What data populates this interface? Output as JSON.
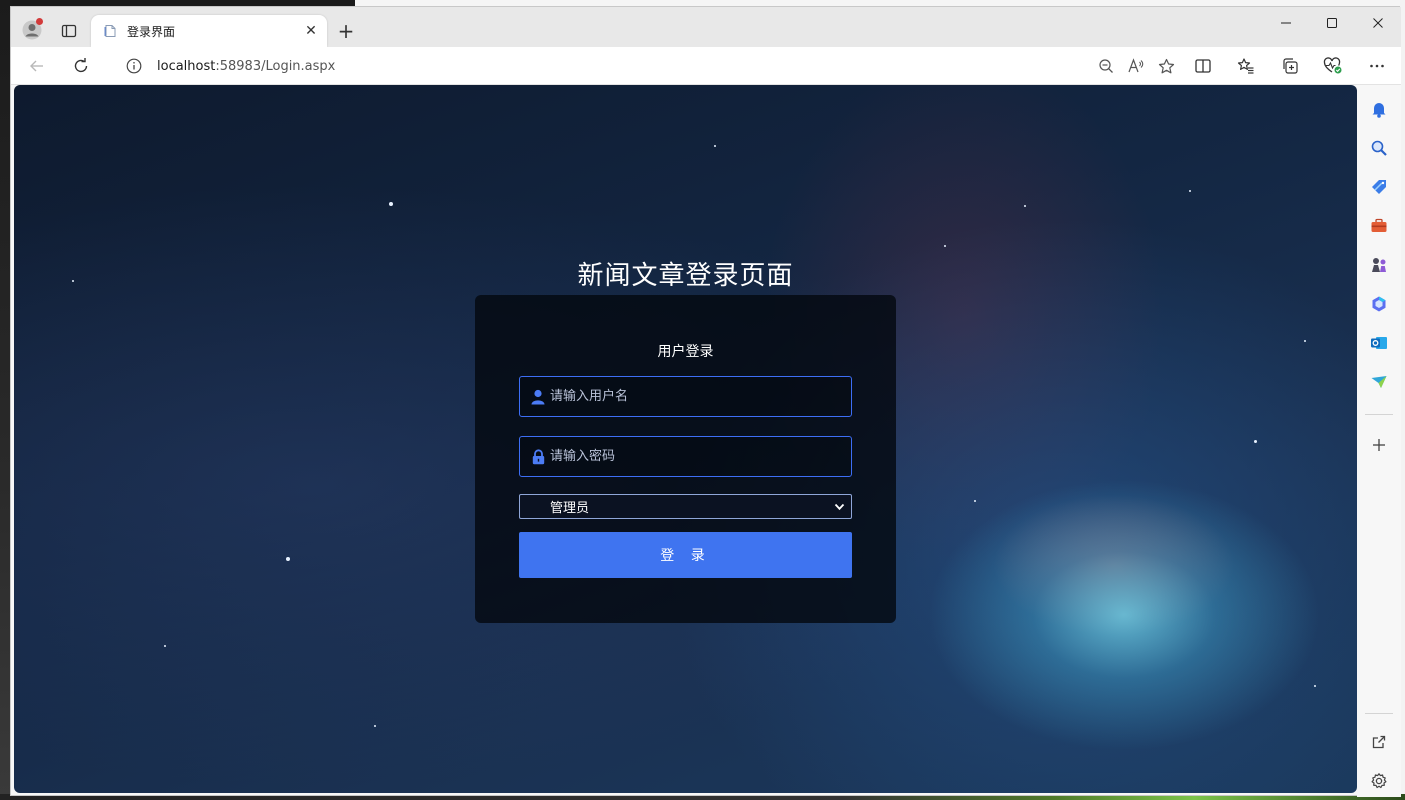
{
  "browser": {
    "tab": {
      "title": "登录界面",
      "close_glyph": "✕"
    },
    "new_tab_glyph": "+",
    "window_controls": {
      "minimize_glyph": "—",
      "maximize_glyph": "☐",
      "close_glyph": "✕"
    },
    "address": {
      "host": "localhost",
      "rest": ":58983/Login.aspx"
    },
    "icons": {
      "profile": "profile-icon",
      "tab_actions": "tab-actions-icon",
      "back": "back-arrow-icon",
      "refresh": "refresh-icon",
      "info": "info-icon",
      "zoom_out": "zoom-out-icon",
      "read_aloud": "read-aloud-icon",
      "favorite": "star-icon",
      "split_screen": "split-screen-icon",
      "favorites": "favorites-icon",
      "collections": "collections-icon",
      "performance": "performance-icon",
      "more": "more-icon"
    },
    "sidebar_icons": [
      "bell-icon",
      "search-icon",
      "shopping-tag-icon",
      "toolbox-icon",
      "games-icon",
      "m365-icon",
      "outlook-icon",
      "drop-icon",
      "add-icon",
      "open-external-icon",
      "settings-icon"
    ]
  },
  "page": {
    "heading": "新闻文章登录页面",
    "card_title": "用户登录",
    "username_placeholder": "请输入用户名",
    "password_placeholder": "请输入密码",
    "role_selected": "管理员",
    "login_button": "登 录",
    "colors": {
      "accent": "#3f74f0",
      "input_border": "#3d6ef5"
    }
  }
}
